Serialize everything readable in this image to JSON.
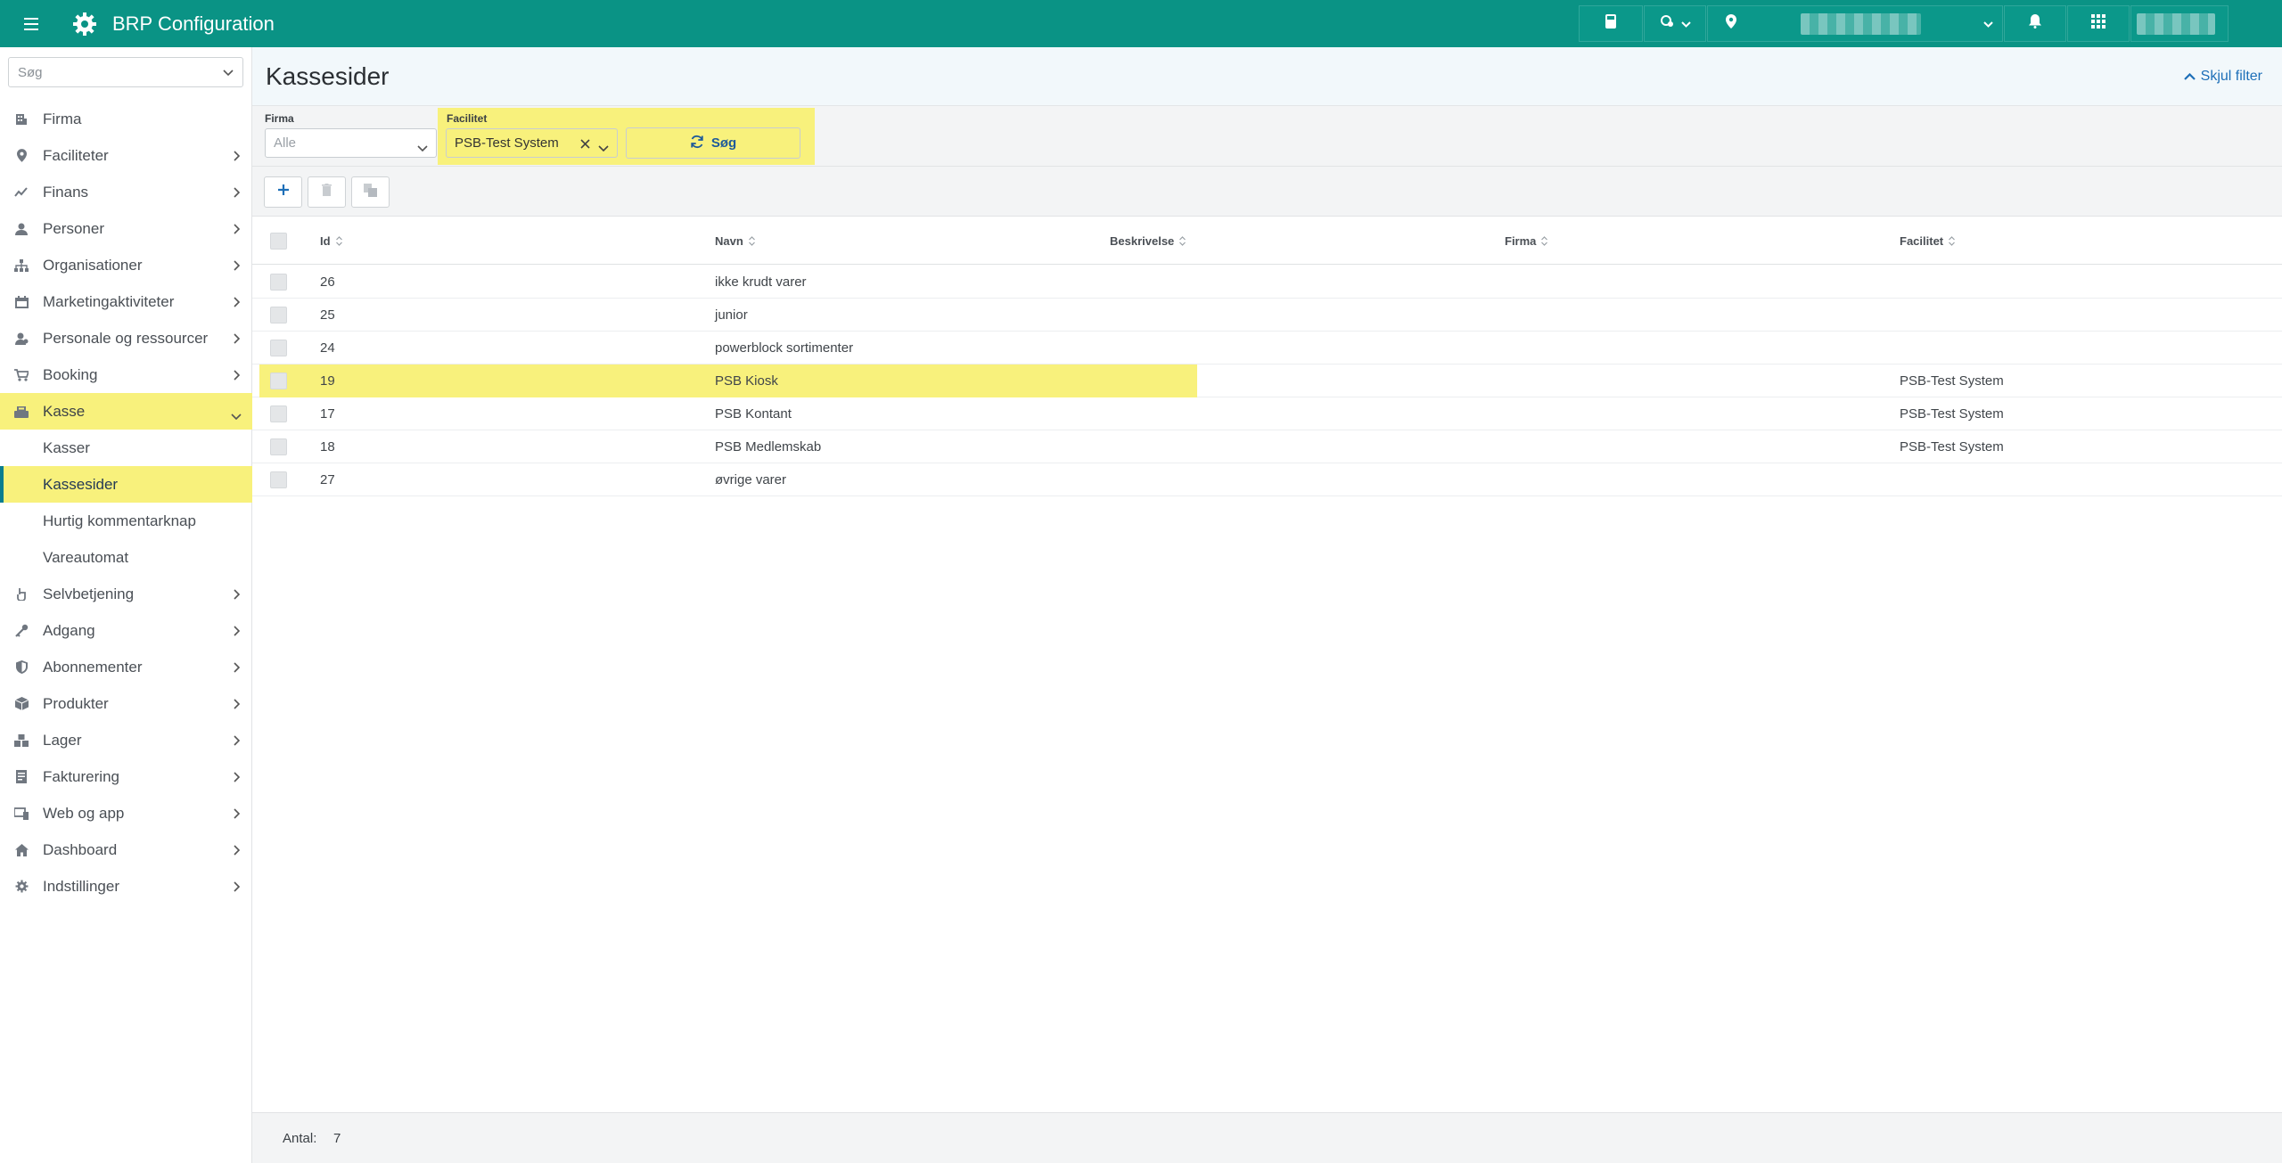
{
  "app": {
    "title": "BRP Configuration"
  },
  "sidebar": {
    "search_placeholder": "Søg",
    "items": [
      {
        "label": "Firma",
        "icon": "building-icon"
      },
      {
        "label": "Faciliteter",
        "icon": "location-pin-icon"
      },
      {
        "label": "Finans",
        "icon": "chart-line-icon"
      },
      {
        "label": "Personer",
        "icon": "person-icon"
      },
      {
        "label": "Organisationer",
        "icon": "org-chart-icon"
      },
      {
        "label": "Marketingaktiviteter",
        "icon": "calendar-icon"
      },
      {
        "label": "Personale og ressourcer",
        "icon": "staff-icon"
      },
      {
        "label": "Booking",
        "icon": "cart-icon"
      },
      {
        "label": "Kasse",
        "icon": "cash-register-icon"
      },
      {
        "label": "Selvbetjening",
        "icon": "hand-pointer-icon"
      },
      {
        "label": "Adgang",
        "icon": "key-icon"
      },
      {
        "label": "Abonnementer",
        "icon": "shield-icon"
      },
      {
        "label": "Produkter",
        "icon": "box-icon"
      },
      {
        "label": "Lager",
        "icon": "boxes-icon"
      },
      {
        "label": "Fakturering",
        "icon": "invoice-icon"
      },
      {
        "label": "Web og app",
        "icon": "devices-icon"
      },
      {
        "label": "Dashboard",
        "icon": "home-icon"
      },
      {
        "label": "Indstillinger",
        "icon": "gear-icon"
      }
    ],
    "kasse_children": [
      "Kasser",
      "Kassesider",
      "Hurtig kommentarknap",
      "Vareautomat"
    ]
  },
  "page": {
    "title": "Kassesider",
    "hide_filter": "Skjul filter"
  },
  "filters": {
    "firma_label": "Firma",
    "firma_placeholder": "Alle",
    "facilitet_label": "Facilitet",
    "facilitet_value": "PSB-Test System",
    "search_button": "Søg"
  },
  "table": {
    "columns": [
      "Id",
      "Navn",
      "Beskrivelse",
      "Firma",
      "Facilitet"
    ],
    "rows": [
      {
        "id": "26",
        "navn": "ikke krudt varer",
        "beskrivelse": "",
        "firma": "",
        "facilitet": ""
      },
      {
        "id": "25",
        "navn": "junior",
        "beskrivelse": "",
        "firma": "",
        "facilitet": ""
      },
      {
        "id": "24",
        "navn": "powerblock sortimenter",
        "beskrivelse": "",
        "firma": "",
        "facilitet": ""
      },
      {
        "id": "19",
        "navn": "PSB Kiosk",
        "beskrivelse": "",
        "firma": "",
        "facilitet": "PSB-Test System"
      },
      {
        "id": "17",
        "navn": "PSB Kontant",
        "beskrivelse": "",
        "firma": "",
        "facilitet": "PSB-Test System"
      },
      {
        "id": "18",
        "navn": "PSB Medlemskab",
        "beskrivelse": "",
        "firma": "",
        "facilitet": "PSB-Test System"
      },
      {
        "id": "27",
        "navn": "øvrige varer",
        "beskrivelse": "",
        "firma": "",
        "facilitet": ""
      }
    ]
  },
  "footer": {
    "count_label": "Antal:",
    "count_value": "7"
  },
  "colors": {
    "topbar": "#0a9385",
    "highlight": "#f8f17c",
    "accent": "#1d6fb8"
  }
}
